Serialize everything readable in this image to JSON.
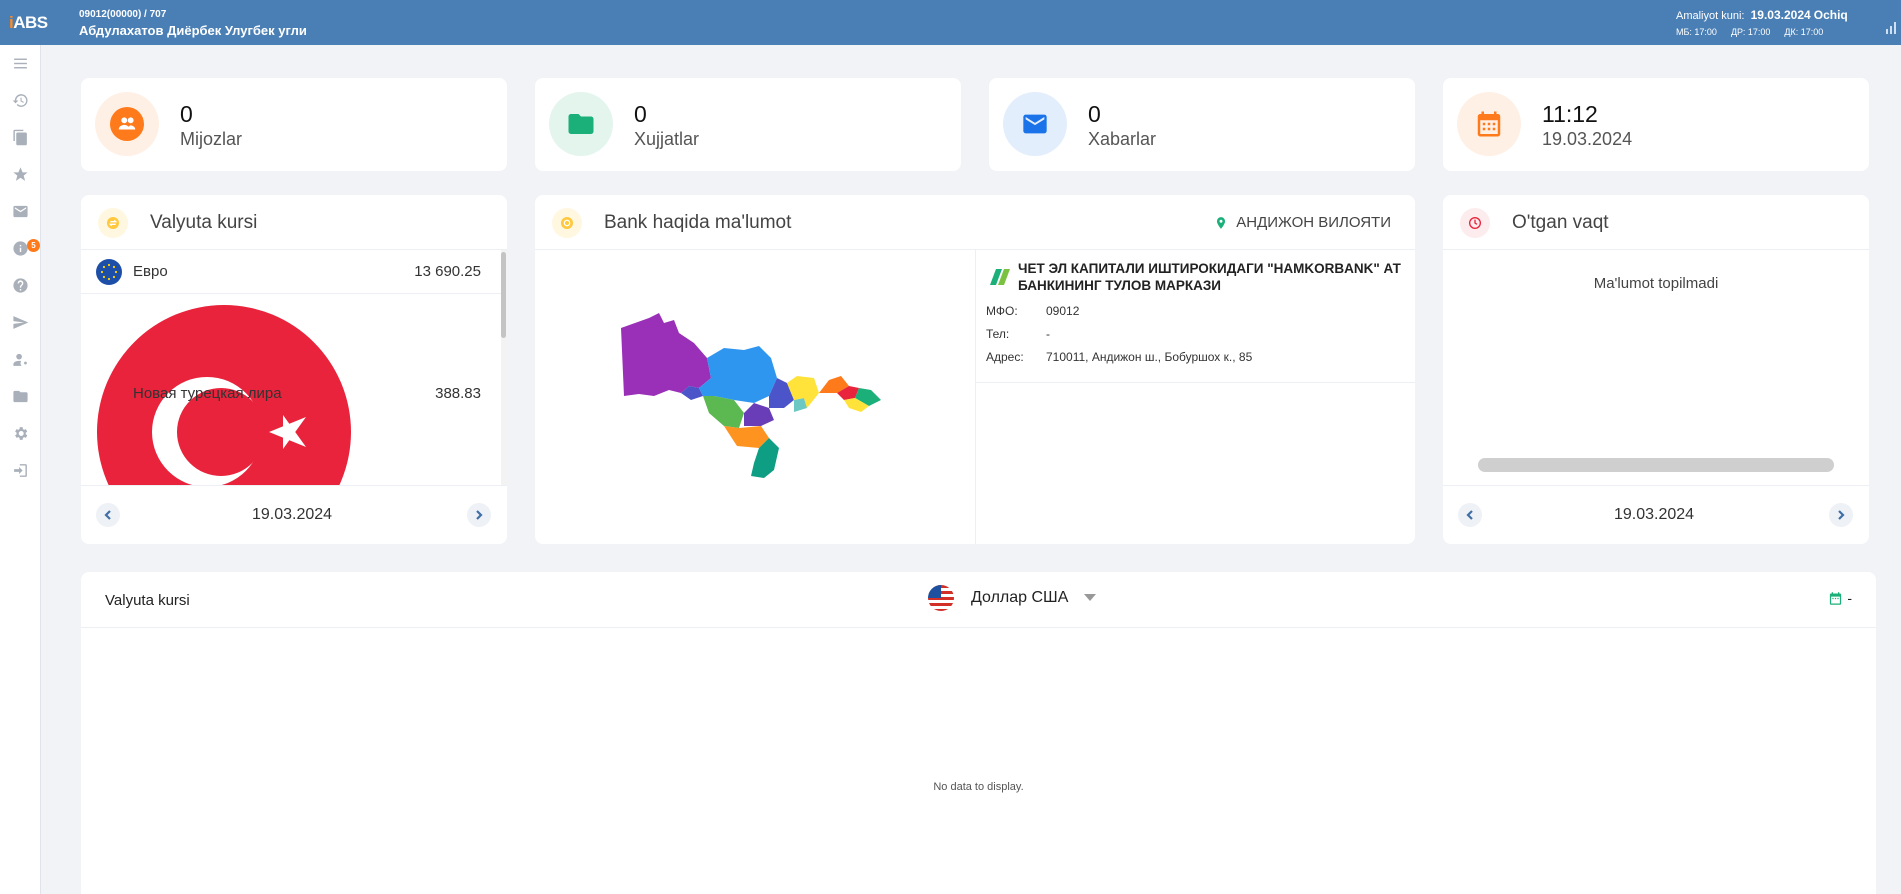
{
  "topbar": {
    "logo_prefix": "i",
    "logo_main": "ABS",
    "user_code": "09012(00000) / 707",
    "user_name": "Абдулахатов Диёрбек Улугбек угли",
    "opday_label": "Amaliyot kuni:",
    "opday_date": "19.03.2024",
    "opday_status": "Ochiq",
    "times": [
      "МБ: 17:00",
      "ДР: 17:00",
      "ДК: 17:00"
    ]
  },
  "sidebar": {
    "items": [
      "menu-icon",
      "history-icon",
      "documents-icon",
      "star-icon",
      "mail-icon",
      "info-icon",
      "help-icon",
      "send-icon",
      "user-settings-icon",
      "folder-icon",
      "settings-icon",
      "logout-icon"
    ],
    "mail_badge": "5"
  },
  "stats": [
    {
      "value": "0",
      "label": "Mijozlar",
      "icon": "users-icon",
      "color": "#ff7a1a"
    },
    {
      "value": "0",
      "label": "Xujjatlar",
      "icon": "folder-icon",
      "color": "#1bb07a"
    },
    {
      "value": "0",
      "label": "Xabarlar",
      "icon": "envelope-icon",
      "color": "#1a73e8"
    },
    {
      "value": "11:12",
      "label": "19.03.2024",
      "icon": "calendar-icon",
      "color": "#ff7a1a"
    }
  ],
  "currency_card": {
    "title": "Valyuta kursi",
    "rows": [
      {
        "name": "Евро",
        "value": "13 690.25"
      },
      {
        "name": "Новая турецкая лира",
        "value": "388.83"
      }
    ],
    "date": "19.03.2024"
  },
  "bank_card": {
    "title": "Bank haqida ma'lumot",
    "region": "АНДИЖОН ВИЛОЯТИ",
    "bank_name": "ЧЕТ ЭЛ КАПИТАЛИ ИШТИРОКИДАГИ \"HAMKORBANK\" АТ БАНКИНИНГ ТУЛОВ МАРКАЗИ",
    "fields": [
      {
        "label": "МФО:",
        "value": "09012"
      },
      {
        "label": "Тел:",
        "value": "-"
      },
      {
        "label": "Адрес:",
        "value": "710011, Андижон ш., Бобуршох к., 85"
      }
    ]
  },
  "time_card": {
    "title": "O'tgan vaqt",
    "empty": "Ma'lumot topilmadi",
    "date": "19.03.2024"
  },
  "bottom": {
    "title": "Valyuta kursi",
    "currency": "Доллар США",
    "date_value": "-",
    "no_data": "No data to display."
  }
}
